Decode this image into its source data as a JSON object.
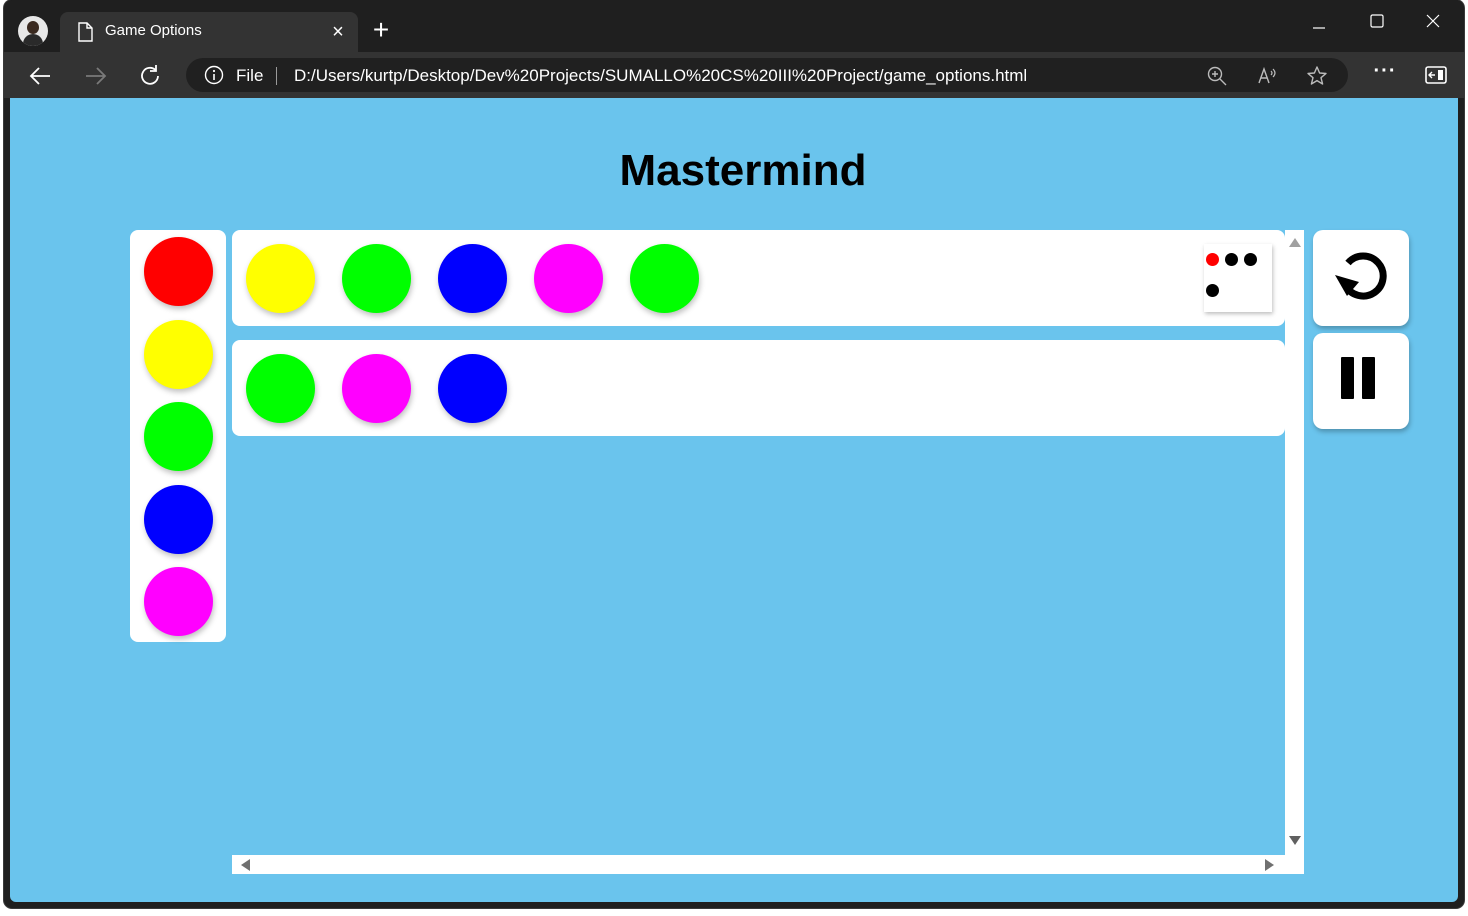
{
  "browser": {
    "tab_title": "Game Options",
    "file_label": "File",
    "url": "D:/Users/kurtp/Desktop/Dev%20Projects/SUMALLO%20CS%20III%20Project/game_options.html",
    "more_label": "···"
  },
  "page": {
    "title": "Mastermind",
    "background": "#6ac4ed"
  },
  "palette": {
    "colors": [
      "#ff0000",
      "#ffff00",
      "#00ff00",
      "#0000ff",
      "#ff00ff"
    ]
  },
  "guesses": [
    {
      "pegs": [
        "#ffff00",
        "#00ff00",
        "#0000ff",
        "#ff00ff",
        "#00ff00"
      ],
      "feedback": [
        "#ff0000",
        "#000000",
        "#000000",
        "#000000"
      ]
    },
    {
      "pegs": [
        "#00ff00",
        "#ff00ff",
        "#0000ff"
      ],
      "feedback": []
    }
  ],
  "controls": {
    "restart_icon": "restart-icon",
    "pause_icon": "pause-icon"
  }
}
